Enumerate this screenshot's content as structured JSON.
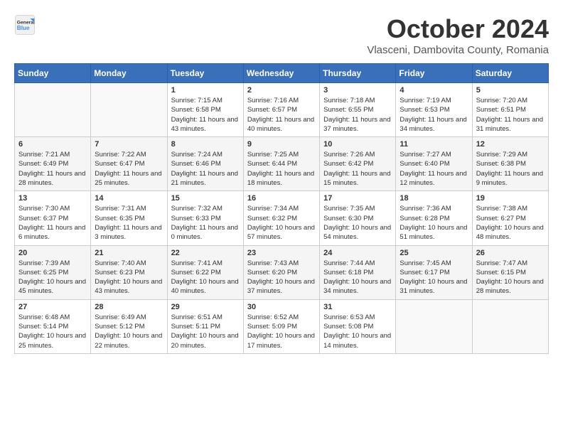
{
  "header": {
    "logo_line1": "General",
    "logo_line2": "Blue",
    "month_title": "October 2024",
    "location": "Vlasceni, Dambovita County, Romania"
  },
  "weekdays": [
    "Sunday",
    "Monday",
    "Tuesday",
    "Wednesday",
    "Thursday",
    "Friday",
    "Saturday"
  ],
  "weeks": [
    [
      {
        "day": "",
        "info": ""
      },
      {
        "day": "",
        "info": ""
      },
      {
        "day": "1",
        "info": "Sunrise: 7:15 AM\nSunset: 6:58 PM\nDaylight: 11 hours and 43 minutes."
      },
      {
        "day": "2",
        "info": "Sunrise: 7:16 AM\nSunset: 6:57 PM\nDaylight: 11 hours and 40 minutes."
      },
      {
        "day": "3",
        "info": "Sunrise: 7:18 AM\nSunset: 6:55 PM\nDaylight: 11 hours and 37 minutes."
      },
      {
        "day": "4",
        "info": "Sunrise: 7:19 AM\nSunset: 6:53 PM\nDaylight: 11 hours and 34 minutes."
      },
      {
        "day": "5",
        "info": "Sunrise: 7:20 AM\nSunset: 6:51 PM\nDaylight: 11 hours and 31 minutes."
      }
    ],
    [
      {
        "day": "6",
        "info": "Sunrise: 7:21 AM\nSunset: 6:49 PM\nDaylight: 11 hours and 28 minutes."
      },
      {
        "day": "7",
        "info": "Sunrise: 7:22 AM\nSunset: 6:47 PM\nDaylight: 11 hours and 25 minutes."
      },
      {
        "day": "8",
        "info": "Sunrise: 7:24 AM\nSunset: 6:46 PM\nDaylight: 11 hours and 21 minutes."
      },
      {
        "day": "9",
        "info": "Sunrise: 7:25 AM\nSunset: 6:44 PM\nDaylight: 11 hours and 18 minutes."
      },
      {
        "day": "10",
        "info": "Sunrise: 7:26 AM\nSunset: 6:42 PM\nDaylight: 11 hours and 15 minutes."
      },
      {
        "day": "11",
        "info": "Sunrise: 7:27 AM\nSunset: 6:40 PM\nDaylight: 11 hours and 12 minutes."
      },
      {
        "day": "12",
        "info": "Sunrise: 7:29 AM\nSunset: 6:38 PM\nDaylight: 11 hours and 9 minutes."
      }
    ],
    [
      {
        "day": "13",
        "info": "Sunrise: 7:30 AM\nSunset: 6:37 PM\nDaylight: 11 hours and 6 minutes."
      },
      {
        "day": "14",
        "info": "Sunrise: 7:31 AM\nSunset: 6:35 PM\nDaylight: 11 hours and 3 minutes."
      },
      {
        "day": "15",
        "info": "Sunrise: 7:32 AM\nSunset: 6:33 PM\nDaylight: 11 hours and 0 minutes."
      },
      {
        "day": "16",
        "info": "Sunrise: 7:34 AM\nSunset: 6:32 PM\nDaylight: 10 hours and 57 minutes."
      },
      {
        "day": "17",
        "info": "Sunrise: 7:35 AM\nSunset: 6:30 PM\nDaylight: 10 hours and 54 minutes."
      },
      {
        "day": "18",
        "info": "Sunrise: 7:36 AM\nSunset: 6:28 PM\nDaylight: 10 hours and 51 minutes."
      },
      {
        "day": "19",
        "info": "Sunrise: 7:38 AM\nSunset: 6:27 PM\nDaylight: 10 hours and 48 minutes."
      }
    ],
    [
      {
        "day": "20",
        "info": "Sunrise: 7:39 AM\nSunset: 6:25 PM\nDaylight: 10 hours and 45 minutes."
      },
      {
        "day": "21",
        "info": "Sunrise: 7:40 AM\nSunset: 6:23 PM\nDaylight: 10 hours and 43 minutes."
      },
      {
        "day": "22",
        "info": "Sunrise: 7:41 AM\nSunset: 6:22 PM\nDaylight: 10 hours and 40 minutes."
      },
      {
        "day": "23",
        "info": "Sunrise: 7:43 AM\nSunset: 6:20 PM\nDaylight: 10 hours and 37 minutes."
      },
      {
        "day": "24",
        "info": "Sunrise: 7:44 AM\nSunset: 6:18 PM\nDaylight: 10 hours and 34 minutes."
      },
      {
        "day": "25",
        "info": "Sunrise: 7:45 AM\nSunset: 6:17 PM\nDaylight: 10 hours and 31 minutes."
      },
      {
        "day": "26",
        "info": "Sunrise: 7:47 AM\nSunset: 6:15 PM\nDaylight: 10 hours and 28 minutes."
      }
    ],
    [
      {
        "day": "27",
        "info": "Sunrise: 6:48 AM\nSunset: 5:14 PM\nDaylight: 10 hours and 25 minutes."
      },
      {
        "day": "28",
        "info": "Sunrise: 6:49 AM\nSunset: 5:12 PM\nDaylight: 10 hours and 22 minutes."
      },
      {
        "day": "29",
        "info": "Sunrise: 6:51 AM\nSunset: 5:11 PM\nDaylight: 10 hours and 20 minutes."
      },
      {
        "day": "30",
        "info": "Sunrise: 6:52 AM\nSunset: 5:09 PM\nDaylight: 10 hours and 17 minutes."
      },
      {
        "day": "31",
        "info": "Sunrise: 6:53 AM\nSunset: 5:08 PM\nDaylight: 10 hours and 14 minutes."
      },
      {
        "day": "",
        "info": ""
      },
      {
        "day": "",
        "info": ""
      }
    ]
  ]
}
